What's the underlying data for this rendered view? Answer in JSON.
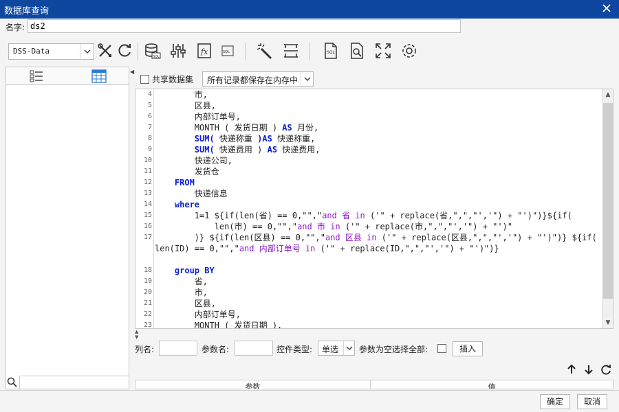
{
  "window": {
    "title": "数据库查询"
  },
  "name_field": {
    "label": "名字:",
    "value": "ds2"
  },
  "toolbar": {
    "datasource": "DSS-Data",
    "icons": [
      "tools-icon",
      "refresh-icon",
      "database-sql-icon",
      "sliders-icon",
      "formula-fx-icon",
      "sql-doc-icon",
      "wand-icon",
      "split-rows-icon",
      "sql-file-icon",
      "preview-icon",
      "fullscreen-icon",
      "gear-icon"
    ]
  },
  "share": {
    "label": "共享数据集",
    "checked": false,
    "memory_option": "所有记录都保存在内存中"
  },
  "editor": {
    "lines": [
      {
        "n": "4",
        "tokens": [
          {
            "t": "        市,"
          }
        ]
      },
      {
        "n": "5",
        "tokens": [
          {
            "t": "        区县,"
          }
        ]
      },
      {
        "n": "6",
        "tokens": [
          {
            "t": "        内部订单号,"
          }
        ]
      },
      {
        "n": "7",
        "tokens": [
          {
            "t": "        MONTH ( 发货日期 ) "
          },
          {
            "t": "AS",
            "c": "kw"
          },
          {
            "t": " 月份,"
          }
        ]
      },
      {
        "n": "8",
        "tokens": [
          {
            "t": "        "
          },
          {
            "t": "SUM(",
            "c": "kw"
          },
          {
            "t": " 快递称重 "
          },
          {
            "t": ")AS",
            "c": "kw"
          },
          {
            "t": " 快递称重,"
          }
        ]
      },
      {
        "n": "9",
        "tokens": [
          {
            "t": "        "
          },
          {
            "t": "SUM(",
            "c": "kw"
          },
          {
            "t": " 快递费用 ) "
          },
          {
            "t": "AS",
            "c": "kw"
          },
          {
            "t": " 快递费用,"
          }
        ]
      },
      {
        "n": "10",
        "tokens": [
          {
            "t": "        快递公司,"
          }
        ]
      },
      {
        "n": "11",
        "tokens": [
          {
            "t": "        发货仓"
          }
        ]
      },
      {
        "n": "12",
        "tokens": [
          {
            "t": "    "
          },
          {
            "t": "FROM",
            "c": "kw"
          }
        ]
      },
      {
        "n": "13",
        "tokens": [
          {
            "t": "        快递信息"
          }
        ]
      },
      {
        "n": "14",
        "tokens": [
          {
            "t": "    "
          },
          {
            "t": "where",
            "c": "kw"
          }
        ]
      },
      {
        "n": "15",
        "tokens": [
          {
            "t": "        1=1 ${if(len(省) == 0,\"\",\""
          },
          {
            "t": "and 省 in",
            "c": "str"
          },
          {
            "t": " ('\" + replace(省,\",\",\"','\") + \"')\")}${if("
          }
        ]
      },
      {
        "n": "16",
        "tokens": [
          {
            "t": "            len(市) == 0,\"\",\""
          },
          {
            "t": "and 市 in",
            "c": "str"
          },
          {
            "t": " ('\" + replace(市,\",\",\"','\") + \"')\""
          }
        ]
      },
      {
        "n": "17",
        "tokens": [
          {
            "t": "        )} ${if(len(区县) == 0,\"\",\""
          },
          {
            "t": "and 区县 in",
            "c": "str"
          },
          {
            "t": " ('\" + replace(区县,\",\",\"','\") + \"')\")} ${if("
          }
        ]
      },
      {
        "n": "",
        "tokens": [
          {
            "t": "len(ID) == 0,\"\",\""
          },
          {
            "t": "and 内部订单号 in",
            "c": "str"
          },
          {
            "t": " ('\" + replace(ID,\",\",\"','\") + \"')\")}"
          }
        ]
      },
      {
        "n": "18",
        "tokens": [
          {
            "t": "    "
          },
          {
            "t": "group BY",
            "c": "kw"
          }
        ]
      },
      {
        "n": "19",
        "tokens": [
          {
            "t": "        省,"
          }
        ]
      },
      {
        "n": "20",
        "tokens": [
          {
            "t": "        市,"
          }
        ]
      },
      {
        "n": "21",
        "tokens": [
          {
            "t": "        区县,"
          }
        ]
      },
      {
        "n": "22",
        "tokens": [
          {
            "t": "        内部订单号,"
          }
        ]
      },
      {
        "n": "23",
        "tokens": [
          {
            "t": "        MONTH ( 发货日期 ),"
          }
        ]
      }
    ]
  },
  "param_row": {
    "col_label": "列名:",
    "param_name_label": "参数名:",
    "control_type_label": "控件类型:",
    "control_type_value": "单选",
    "empty_select_all_label": "参数为空选择全部:",
    "insert_button": "插入"
  },
  "param_table": {
    "col_param": "参数",
    "col_value": "值"
  },
  "footer": {
    "ok": "确定",
    "cancel": "取消"
  },
  "colors": {
    "titlebar": "#0d47a0",
    "keyword": "#0a1cd6",
    "string": "#8b1ac0"
  }
}
